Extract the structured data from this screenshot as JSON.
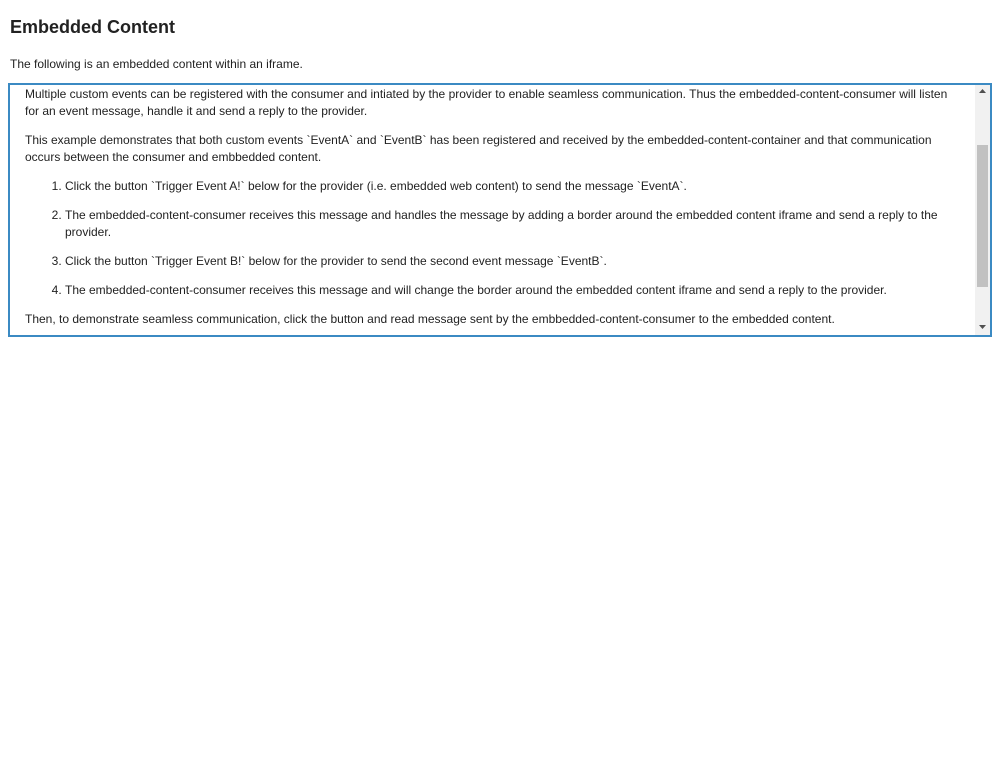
{
  "page": {
    "title": "Embedded Content",
    "intro": "The following is an embedded content within an iframe."
  },
  "iframe": {
    "paragraph_1": "Multiple custom events can be registered with the consumer and intiated by the provider to enable seamless communication. Thus the embedded-content-consumer will listen for an event message, handle it and send a reply to the provider.",
    "paragraph_2": "This example demonstrates that both custom events `EventA` and `EventB` has been registered and received by the embedded-content-container and that communication occurs between the consumer and embbedded content.",
    "steps": [
      "Click the button `Trigger Event A!` below for the provider (i.e. embedded web content) to send the message `EventA`.",
      "The embedded-content-consumer receives this message and handles the message by adding a border around the embedded content iframe and send a reply to the provider.",
      "Click the button `Trigger Event B!` below for the provider to send the second event message `EventB`.",
      "The embedded-content-consumer receives this message and will change the border around the embedded content iframe and send a reply to the provider."
    ],
    "paragraph_3": "Then, to demonstrate seamless communication, click the button and read message sent by the embbedded-content-consumer to the embedded content."
  },
  "colors": {
    "iframe_border": "#3b8ac3",
    "scroll_thumb": "#c1c1c1",
    "scroll_track": "#f1f1f1"
  },
  "icons": {
    "scroll_up": "triangle-up-icon",
    "scroll_down": "triangle-down-icon"
  }
}
